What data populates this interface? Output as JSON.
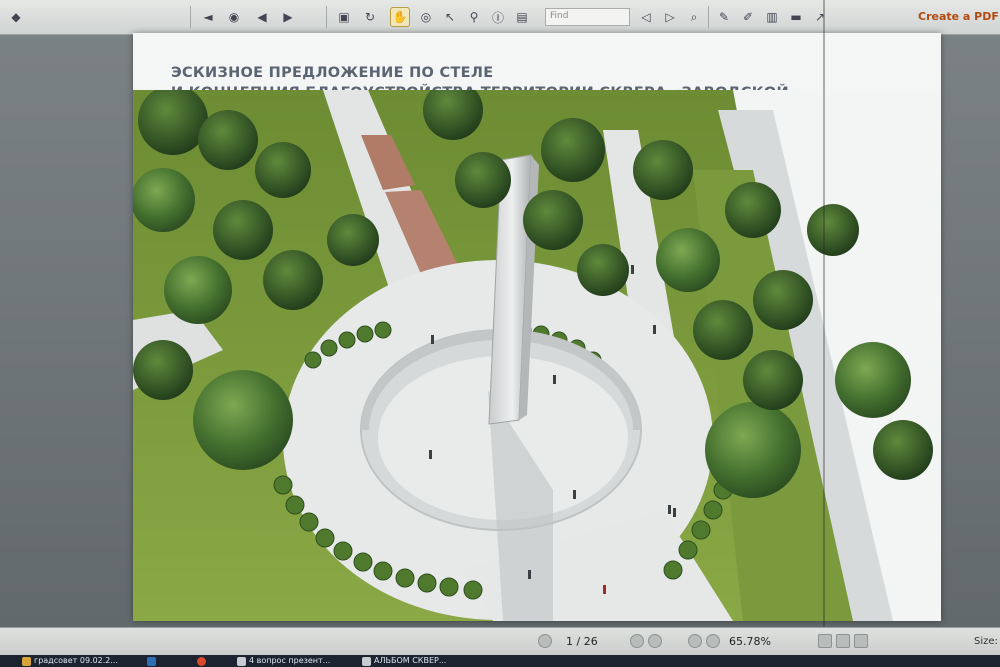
{
  "app": {
    "toolbar": {
      "find_placeholder": "Find",
      "create_pdf_label": "Create a PDF"
    },
    "slide": {
      "title_line1": "ЭСКИЗНОЕ ПРЕДЛОЖЕНИЕ ПО СТЕЛЕ",
      "title_line2": "И КОНЦЕПЦИЯ БЛАГОУСТРОЙСТВА ТЕРРИТОРИИ СКВЕРА «ЗАВОДСКОЙ»"
    },
    "statusbar": {
      "page_indicator": "1 / 26",
      "zoom": "65.78%",
      "size_label": "Size:"
    },
    "taskbar": {
      "items": [
        {
          "label": "градсовет 09.02.2..."
        },
        {
          "label": "4 вопрос презент..."
        },
        {
          "label": "АЛЬБОМ СКВЕР..."
        }
      ]
    },
    "colors": {
      "title_text": "#5b6472",
      "create_pdf": "#b04a10",
      "grass": "#7e9a3e",
      "path": "#e4e6e6"
    }
  }
}
